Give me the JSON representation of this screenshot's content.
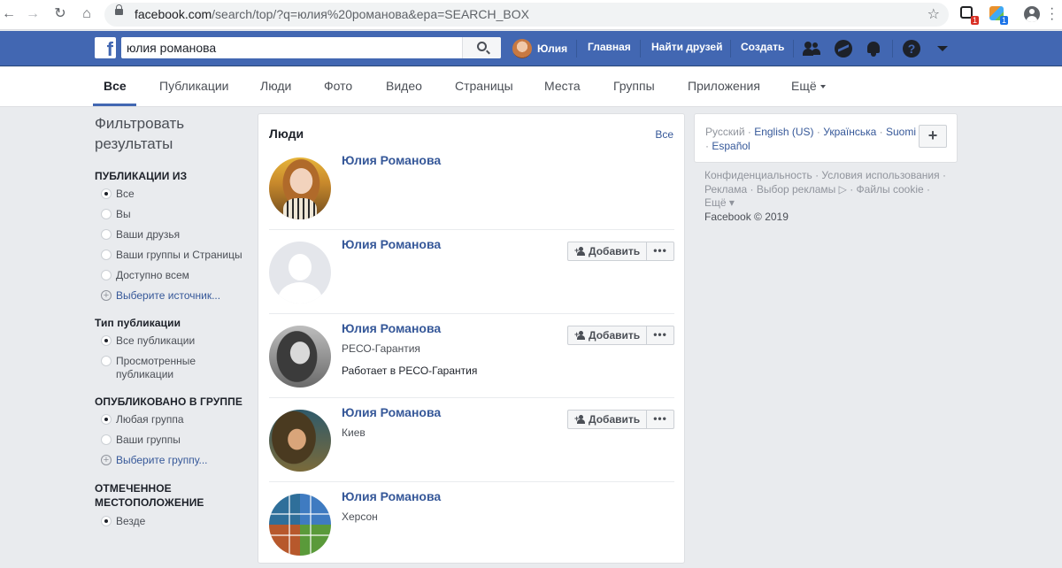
{
  "browser": {
    "url_host": "facebook.com",
    "url_path": "/search/top/?q=юлия%20романова&epa=SEARCH_BOX",
    "ext1_badge": "1",
    "ext2_badge": "1"
  },
  "fb": {
    "search_value": "юлия романова",
    "nav_user": "Юлия",
    "nav_home": "Главная",
    "nav_find_friends": "Найти друзей",
    "nav_create": "Создать",
    "help_glyph": "?"
  },
  "tabs": [
    "Все",
    "Публикации",
    "Люди",
    "Фото",
    "Видео",
    "Страницы",
    "Места",
    "Группы",
    "Приложения",
    "Ещё"
  ],
  "filters": {
    "title": "Фильтровать результаты",
    "groups": [
      {
        "heading": "ПУБЛИКАЦИИ ИЗ",
        "options": [
          "Все",
          "Вы",
          "Ваши друзья",
          "Ваши группы и Страницы",
          "Доступно всем"
        ],
        "selected": 0,
        "link": "Выберите источник..."
      },
      {
        "heading": "Тип публикации",
        "options": [
          "Все публикации",
          "Просмотренные публикации"
        ],
        "selected": 0
      },
      {
        "heading": "ОПУБЛИКОВАНО В ГРУППЕ",
        "options": [
          "Любая группа",
          "Ваши группы"
        ],
        "selected": 0,
        "link": "Выберите группу..."
      },
      {
        "heading": "ОТМЕЧЕННОЕ МЕСТОПОЛОЖЕНИЕ",
        "options": [
          "Везде"
        ],
        "selected": 0
      }
    ]
  },
  "people": {
    "title": "Люди",
    "see_all": "Все",
    "add_label": "Добавить",
    "more_label": "•••",
    "items": [
      {
        "name": "Юлия Романова",
        "sub": "",
        "extra": "",
        "add": false
      },
      {
        "name": "Юлия Романова",
        "sub": "",
        "extra": "",
        "add": true
      },
      {
        "name": "Юлия Романова",
        "sub": "РЕСО-Гарантия",
        "extra": "Работает в РЕСО-Гарантия",
        "add": true
      },
      {
        "name": "Юлия Романова",
        "sub": "Киев",
        "extra": "",
        "add": true
      },
      {
        "name": "Юлия Романова",
        "sub": "Херсон",
        "extra": "",
        "add": false
      }
    ]
  },
  "languages": {
    "current": "Русский",
    "others": [
      "English (US)",
      "Українська",
      "Suomi",
      "Español"
    ],
    "plus": "+"
  },
  "footer": {
    "links": [
      "Конфиденциальность",
      "Условия использования",
      "Реклама",
      "Выбор рекламы",
      "Файлы cookie",
      "Ещё"
    ],
    "copyright": "Facebook © 2019"
  }
}
